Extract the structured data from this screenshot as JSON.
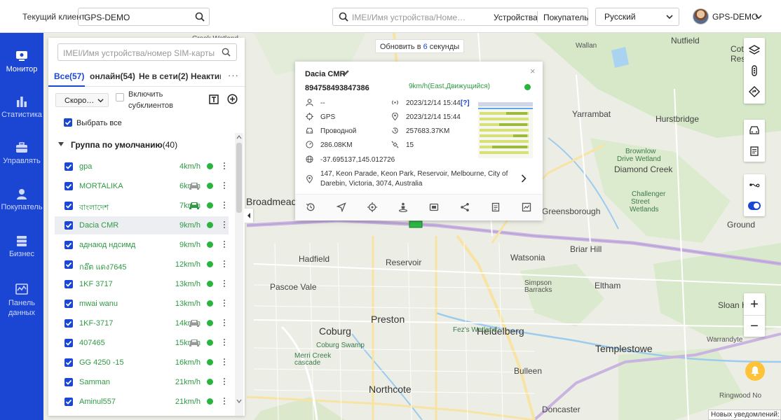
{
  "header": {
    "client_label": "Текущий клиент",
    "client_value": "GPS-DEMO",
    "global_search_placeholder": "IMEI/Имя устройства/Номер SIM-карты/...",
    "search_option_devices": "Устройства",
    "search_option_buyer": "Покупатель",
    "language": "Русский",
    "user_name": "GPS-DEMO"
  },
  "nav": {
    "items": [
      {
        "label": "Монитор",
        "icon": "monitor-icon",
        "active": true
      },
      {
        "label": "Статистика",
        "icon": "bar-chart-icon"
      },
      {
        "label": "Управлять",
        "icon": "briefcase-icon"
      },
      {
        "label": "Покупатель",
        "icon": "user-icon"
      },
      {
        "label": "Бизнес",
        "icon": "stack-icon"
      },
      {
        "label": "Панель данных",
        "icon": "dashboard-icon"
      }
    ]
  },
  "refresh": {
    "prefix": "Обновить в",
    "seconds": "6",
    "suffix": "секунды"
  },
  "panel": {
    "search_placeholder": "IMEI/Имя устройства/номер SIM-карты",
    "tabs": [
      {
        "label": "Все(57)",
        "active": true
      },
      {
        "label": "онлайн(54)"
      },
      {
        "label": "Не в сети(2)"
      },
      {
        "label": "Неактив"
      }
    ],
    "tab_more": "···",
    "sort_select": "Скоро…",
    "include_sub_label": "Включить субклиентов",
    "select_all": "Выбрать все",
    "group_name": "Группа по умолчанию",
    "group_count": "(40)",
    "devices": [
      {
        "name": "gpa",
        "speed": "4km/h",
        "car": false
      },
      {
        "name": "MORTALIKA",
        "speed": "6km/h",
        "car": true,
        "car_color": "#999999"
      },
      {
        "name": "বাংলাদেশ",
        "speed": "7km/h",
        "car": true,
        "car_color": "#2e9a44"
      },
      {
        "name": "Dacia CMR",
        "speed": "9km/h",
        "car": false,
        "selected": true
      },
      {
        "name": "аднаюд ндсимд",
        "speed": "9km/h",
        "car": false
      },
      {
        "name": "กอ๊ต แดง7645",
        "speed": "12km/h",
        "car": false
      },
      {
        "name": "1KF 3717",
        "speed": "13km/h",
        "car": false
      },
      {
        "name": "mwai wanu",
        "speed": "13km/h",
        "car": false
      },
      {
        "name": "1KF-3717",
        "speed": "14km/h",
        "car": true,
        "car_color": "#999999"
      },
      {
        "name": "407465",
        "speed": "15km/h",
        "car": true,
        "car_color": "#999999"
      },
      {
        "name": "GG 4250 -15",
        "speed": "16km/h",
        "car": false
      },
      {
        "name": "Samman",
        "speed": "21km/h",
        "car": false
      },
      {
        "name": "Aminul557",
        "speed": "21km/h",
        "car": false
      }
    ]
  },
  "popup": {
    "title": "Dacia CMR",
    "imei": "894758493847386",
    "status": "9km/h(East,Движущийся)",
    "driver": "--",
    "signal_time": "2023/12/14 15:44",
    "signal_help": "[?]",
    "positioning": "GPS",
    "position_time": "2023/12/14 15:44",
    "connection": "Проводной",
    "total_mileage": "257683.37KM",
    "trip_mileage": "286.08KM",
    "satellites": "15",
    "coordinates": "-37.695137,145.012726",
    "address": "147, Keon Parade, Keon Park, Reservoir, Melbourne, City of Darebin, Victoria, 3074, Australia"
  },
  "map": {
    "labels": [
      "Creek Wetland",
      "Nutfield",
      "Cott",
      "Rese",
      "Yarrambat",
      "Hurstbridge",
      "Broadmeadows",
      "Brownlow",
      "Drive Wetland",
      "Diamond Creek",
      "Challenger",
      "Street",
      "Wetlands",
      "Greensborough",
      "Briar Hill",
      "Hadfield",
      "Reservoir",
      "Watsonia",
      "Pascoe Vale",
      "Simpson",
      "Barracks",
      "Eltham",
      "Coburg",
      "Preston",
      "Heidelberg",
      "Coburg Swamp",
      "Fez's Wetland",
      "Templestowe",
      "Merri Creek",
      "cascade",
      "Bulleen",
      "Northcote",
      "Doncaster",
      "Sloan Ha",
      "Warrandyte",
      "Ringwood No",
      "Wallan",
      "Ground"
    ],
    "zoom_in": "+",
    "zoom_out": "−"
  },
  "notification": "Новых уведомлений: 6"
}
